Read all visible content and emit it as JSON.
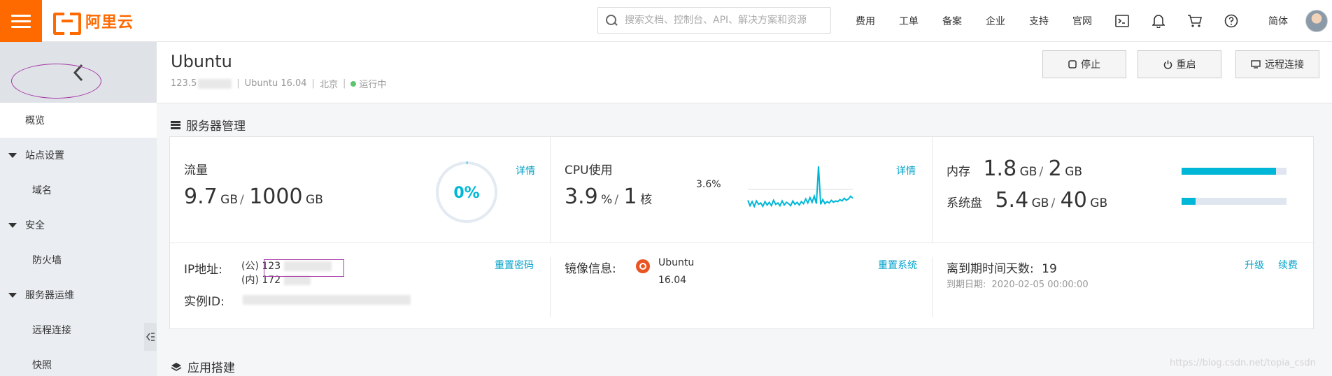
{
  "topbar": {
    "brand": "阿里云",
    "search_placeholder": "搜索文档、控制台、API、解决方案和资源",
    "nav": [
      "费用",
      "工单",
      "备案",
      "企业",
      "支持",
      "官网"
    ],
    "language": "简体",
    "icons": [
      "terminal-icon",
      "bell-icon",
      "cart-icon",
      "help-icon"
    ]
  },
  "sidebar": {
    "overview": "概览",
    "site_settings": "站点设置",
    "domain": "域名",
    "security": "安全",
    "firewall": "防火墙",
    "server_ops": "服务器运维",
    "remote_connect": "远程连接",
    "snapshot": "快照"
  },
  "instance": {
    "name": "Ubuntu",
    "ip_prefix": "123.5",
    "os": "Ubuntu 16.04",
    "region": "北京",
    "status": "运行中",
    "status_color": "#5fc56c"
  },
  "actions": {
    "stop": "停止",
    "restart": "重启",
    "remote": "远程连接"
  },
  "server_mgmt": {
    "title": "服务器管理",
    "traffic": {
      "label": "流量",
      "used": "9.7",
      "used_unit": "GB",
      "total": "1000",
      "total_unit": "GB",
      "percent_text": "0%",
      "percent": 0.005,
      "detail": "详情"
    },
    "cpu": {
      "label": "CPU使用",
      "value": "3.9",
      "unit": "%",
      "cores": "1",
      "cores_unit": "核",
      "peak_label": "3.6%",
      "detail": "详情"
    },
    "memory": {
      "label": "内存",
      "used": "1.8",
      "used_unit": "GB",
      "total": "2",
      "total_unit": "GB",
      "fraction": 0.9
    },
    "disk": {
      "label": "系统盘",
      "used": "5.4",
      "used_unit": "GB",
      "total": "40",
      "total_unit": "GB",
      "fraction": 0.135
    },
    "ip": {
      "label": "IP地址:",
      "public_tag": "(公)",
      "public_prefix": "123",
      "private_tag": "(内)",
      "private_prefix": "172",
      "reset_password": "重置密码"
    },
    "instance_id": {
      "label": "实例ID:"
    },
    "image": {
      "label": "镜像信息:",
      "name": "Ubuntu",
      "version": "16.04",
      "reset_system": "重置系统"
    },
    "expiry": {
      "label": "离到期时间天数:",
      "days": "19",
      "date_label": "到期日期:",
      "date": "2020-02-05 00:00:00",
      "upgrade": "升级",
      "renew": "续费"
    }
  },
  "app_build": {
    "title": "应用搭建"
  },
  "watermark": "https://blog.csdn.net/topia_csdn",
  "chart_data": {
    "type": "line",
    "title": "CPU使用",
    "annotations": [
      "3.6%"
    ],
    "series": [
      {
        "values": [
          2.0,
          1.2,
          1.8,
          1.1,
          1.9,
          1.4,
          1.6,
          1.1,
          1.8,
          1.3,
          1.7,
          1.2,
          2.0,
          1.4,
          1.6,
          1.2,
          1.9,
          1.3,
          1.7,
          1.5,
          1.2,
          1.9,
          1.4,
          1.7,
          1.3,
          1.8,
          1.5,
          2.2,
          1.6,
          2.4,
          1.7,
          2.6,
          1.5,
          7.0,
          1.4,
          2.1,
          1.5,
          1.8,
          1.6,
          2.0,
          1.7,
          1.9,
          1.8,
          2.1,
          1.9,
          2.3,
          2.0,
          2.2,
          2.6,
          2.3
        ]
      }
    ],
    "reference_line": 3.6
  }
}
